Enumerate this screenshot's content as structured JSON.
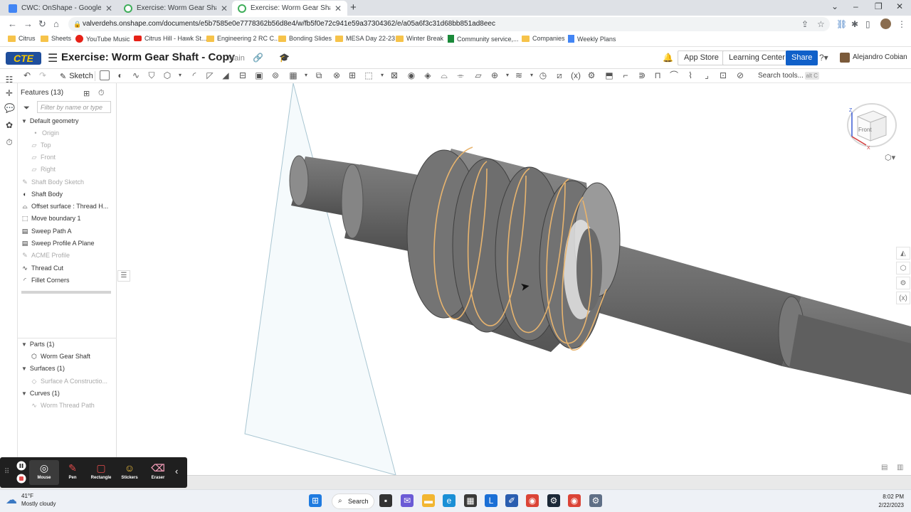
{
  "browser": {
    "tabs": [
      {
        "label": "CWC: OnShape - Google Docs"
      },
      {
        "label": "Exercise: Worm Gear Shaft - Copy"
      },
      {
        "label": "Exercise: Worm Gear Shaft - Copy"
      }
    ],
    "url": "valverdehs.onshape.com/documents/e5b7585e0e7778362b56d8e4/w/fb5f0e72c941e59a37304362/e/a05a6f3c31d68bb851ad8eec",
    "bookmarks": [
      {
        "label": "Citrus",
        "icon": "folder-icon"
      },
      {
        "label": "Sheets",
        "icon": "folder-icon"
      },
      {
        "label": "YouTube Music",
        "icon": "youtube-music-icon"
      },
      {
        "label": "Citrus Hill - Hawk St...",
        "icon": "youtube-icon"
      },
      {
        "label": "Engineering 2 RC C...",
        "icon": "folder-icon"
      },
      {
        "label": "Bonding Slides",
        "icon": "folder-icon"
      },
      {
        "label": "MESA Day 22-23",
        "icon": "folder-icon"
      },
      {
        "label": "Winter Break",
        "icon": "folder-icon"
      },
      {
        "label": "Community service,...",
        "icon": "google-sheets-icon"
      },
      {
        "label": "Companies",
        "icon": "folder-icon"
      },
      {
        "label": "Weekly Plans",
        "icon": "google-docs-icon"
      }
    ]
  },
  "header": {
    "logo": "CTE",
    "title": "Exercise: Worm Gear Shaft - Copy",
    "branch": "Main",
    "app_store": "App Store",
    "learning_center": "Learning Center",
    "share": "Share",
    "user": "Alejandro Cobian"
  },
  "toolbar": {
    "sketch": "Sketch",
    "search_tools": "Search tools...",
    "search_shortcut": "alt C"
  },
  "features": {
    "header": "Features (13)",
    "filter_placeholder": "Filter by name or type",
    "default_geometry": "Default geometry",
    "default_items": [
      "Origin",
      "Top",
      "Front",
      "Right"
    ],
    "items": [
      {
        "label": "Shaft Body Sketch",
        "dim": true
      },
      {
        "label": "Shaft Body",
        "dim": false
      },
      {
        "label": "Offset surface : Thread H...",
        "dim": false
      },
      {
        "label": "Move boundary 1",
        "dim": false
      },
      {
        "label": "Sweep Path A",
        "dim": false
      },
      {
        "label": "Sweep Profile A Plane",
        "dim": false
      },
      {
        "label": "ACME Profile",
        "dim": true
      },
      {
        "label": "Thread Cut",
        "dim": false
      },
      {
        "label": "Fillet Corners",
        "dim": false
      }
    ],
    "parts_group": "Parts (1)",
    "parts_item": "Worm Gear Shaft",
    "surfaces_group": "Surfaces (1)",
    "surfaces_item": "Surface A Constructio...",
    "curves_group": "Curves (1)",
    "curves_item": "Worm Thread Path"
  },
  "viewcube": {
    "face": "Front",
    "axis_z": "Z",
    "axis_x": "X"
  },
  "recorder": {
    "tools": [
      {
        "label": "Mouse",
        "icon": "mouse-pointer-icon"
      },
      {
        "label": "Pen",
        "icon": "pen-icon"
      },
      {
        "label": "Rectangle",
        "icon": "rectangle-icon"
      },
      {
        "label": "Stickers",
        "icon": "emoji-sticker-icon"
      },
      {
        "label": "Eraser",
        "icon": "eraser-icon"
      }
    ]
  },
  "taskbar": {
    "temperature": "41°F",
    "weather": "Mostly cloudy",
    "search": "Search",
    "time": "8:02 PM",
    "date": "2/22/2023"
  }
}
